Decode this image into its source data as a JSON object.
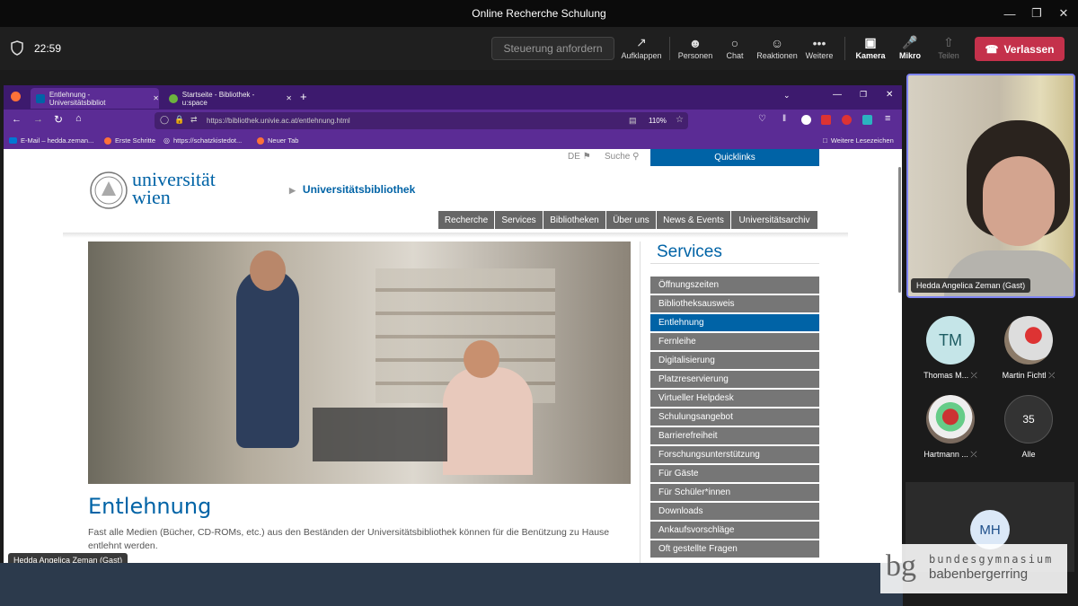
{
  "window": {
    "title": "Online Recherche Schulung"
  },
  "meeting": {
    "timer": "22:59",
    "request_control": "Steuerung anfordern",
    "tools": [
      {
        "label": "Aufklappen",
        "icon": "pop-out-icon"
      },
      {
        "label": "Personen",
        "icon": "people-icon"
      },
      {
        "label": "Chat",
        "icon": "chat-icon"
      },
      {
        "label": "Reaktionen",
        "icon": "reactions-icon"
      },
      {
        "label": "Weitere",
        "icon": "more-icon"
      },
      {
        "label": "Kamera",
        "icon": "camera-off-icon"
      },
      {
        "label": "Mikro",
        "icon": "mic-off-icon"
      },
      {
        "label": "Teilen",
        "icon": "share-icon"
      }
    ],
    "leave": "Verlassen",
    "accent": "#c4314b"
  },
  "browser": {
    "tabs": [
      {
        "label": "Entlehnung - Universitätsbibliot",
        "active": true
      },
      {
        "label": "Startseite - Bibliothek - u:space",
        "active": false
      }
    ],
    "url": "https://bibliothek.univie.ac.at/entlehnung.html",
    "zoom": "110%",
    "bookmarks": [
      "E-Mail – hedda.zeman...",
      "Erste Schritte",
      "https://schatzkistedot...",
      "Neuer Tab"
    ],
    "other_bookmarks": "Weitere Lesezeichen"
  },
  "site": {
    "lang": "DE",
    "search": "Suche",
    "quicklinks": "Quicklinks",
    "logo_line1": "universität",
    "logo_line2": "wien",
    "breadcrumb": "Universitätsbibliothek",
    "nav": [
      "Recherche",
      "Services",
      "Bibliotheken",
      "Über uns",
      "News & Events",
      "Universitätsarchiv"
    ],
    "heading": "Entlehnung",
    "paragraph": "Fast alle Medien (Bücher, CD-ROMs, etc.) aus den Beständen der Universitätsbibliothek können für die Benützung zu Hause entlehnt werden.",
    "services_title": "Services",
    "services": [
      "Öffnungszeiten",
      "Bibliotheksausweis",
      "Entlehnung",
      "Fernleihe",
      "Digitalisierung",
      "Platzreservierung",
      "Virtueller Helpdesk",
      "Schulungsangebot",
      "Barrierefreiheit",
      "Forschungsunterstützung",
      "Für Gäste",
      "Für Schüler*innen",
      "Downloads",
      "Ankaufsvorschläge",
      "Oft gestellte Fragen"
    ],
    "active_service": "Entlehnung",
    "brand_color": "#0063a6"
  },
  "presenter_chip": "Hedda Angelica Zeman (Gast)",
  "participants": {
    "self_name": "Hedda Angelica Zeman (Gast)",
    "list": [
      {
        "initials": "TM",
        "name": "Thomas M..."
      },
      {
        "initials": "",
        "name": "Martin Fichtl"
      },
      {
        "initials": "",
        "name": "Hartmann ..."
      },
      {
        "initials": "35",
        "name": "Alle"
      }
    ],
    "extra_initials": "MH"
  },
  "watermark": {
    "line1": "bundesgymnasium",
    "line2": "babenbergerring"
  }
}
